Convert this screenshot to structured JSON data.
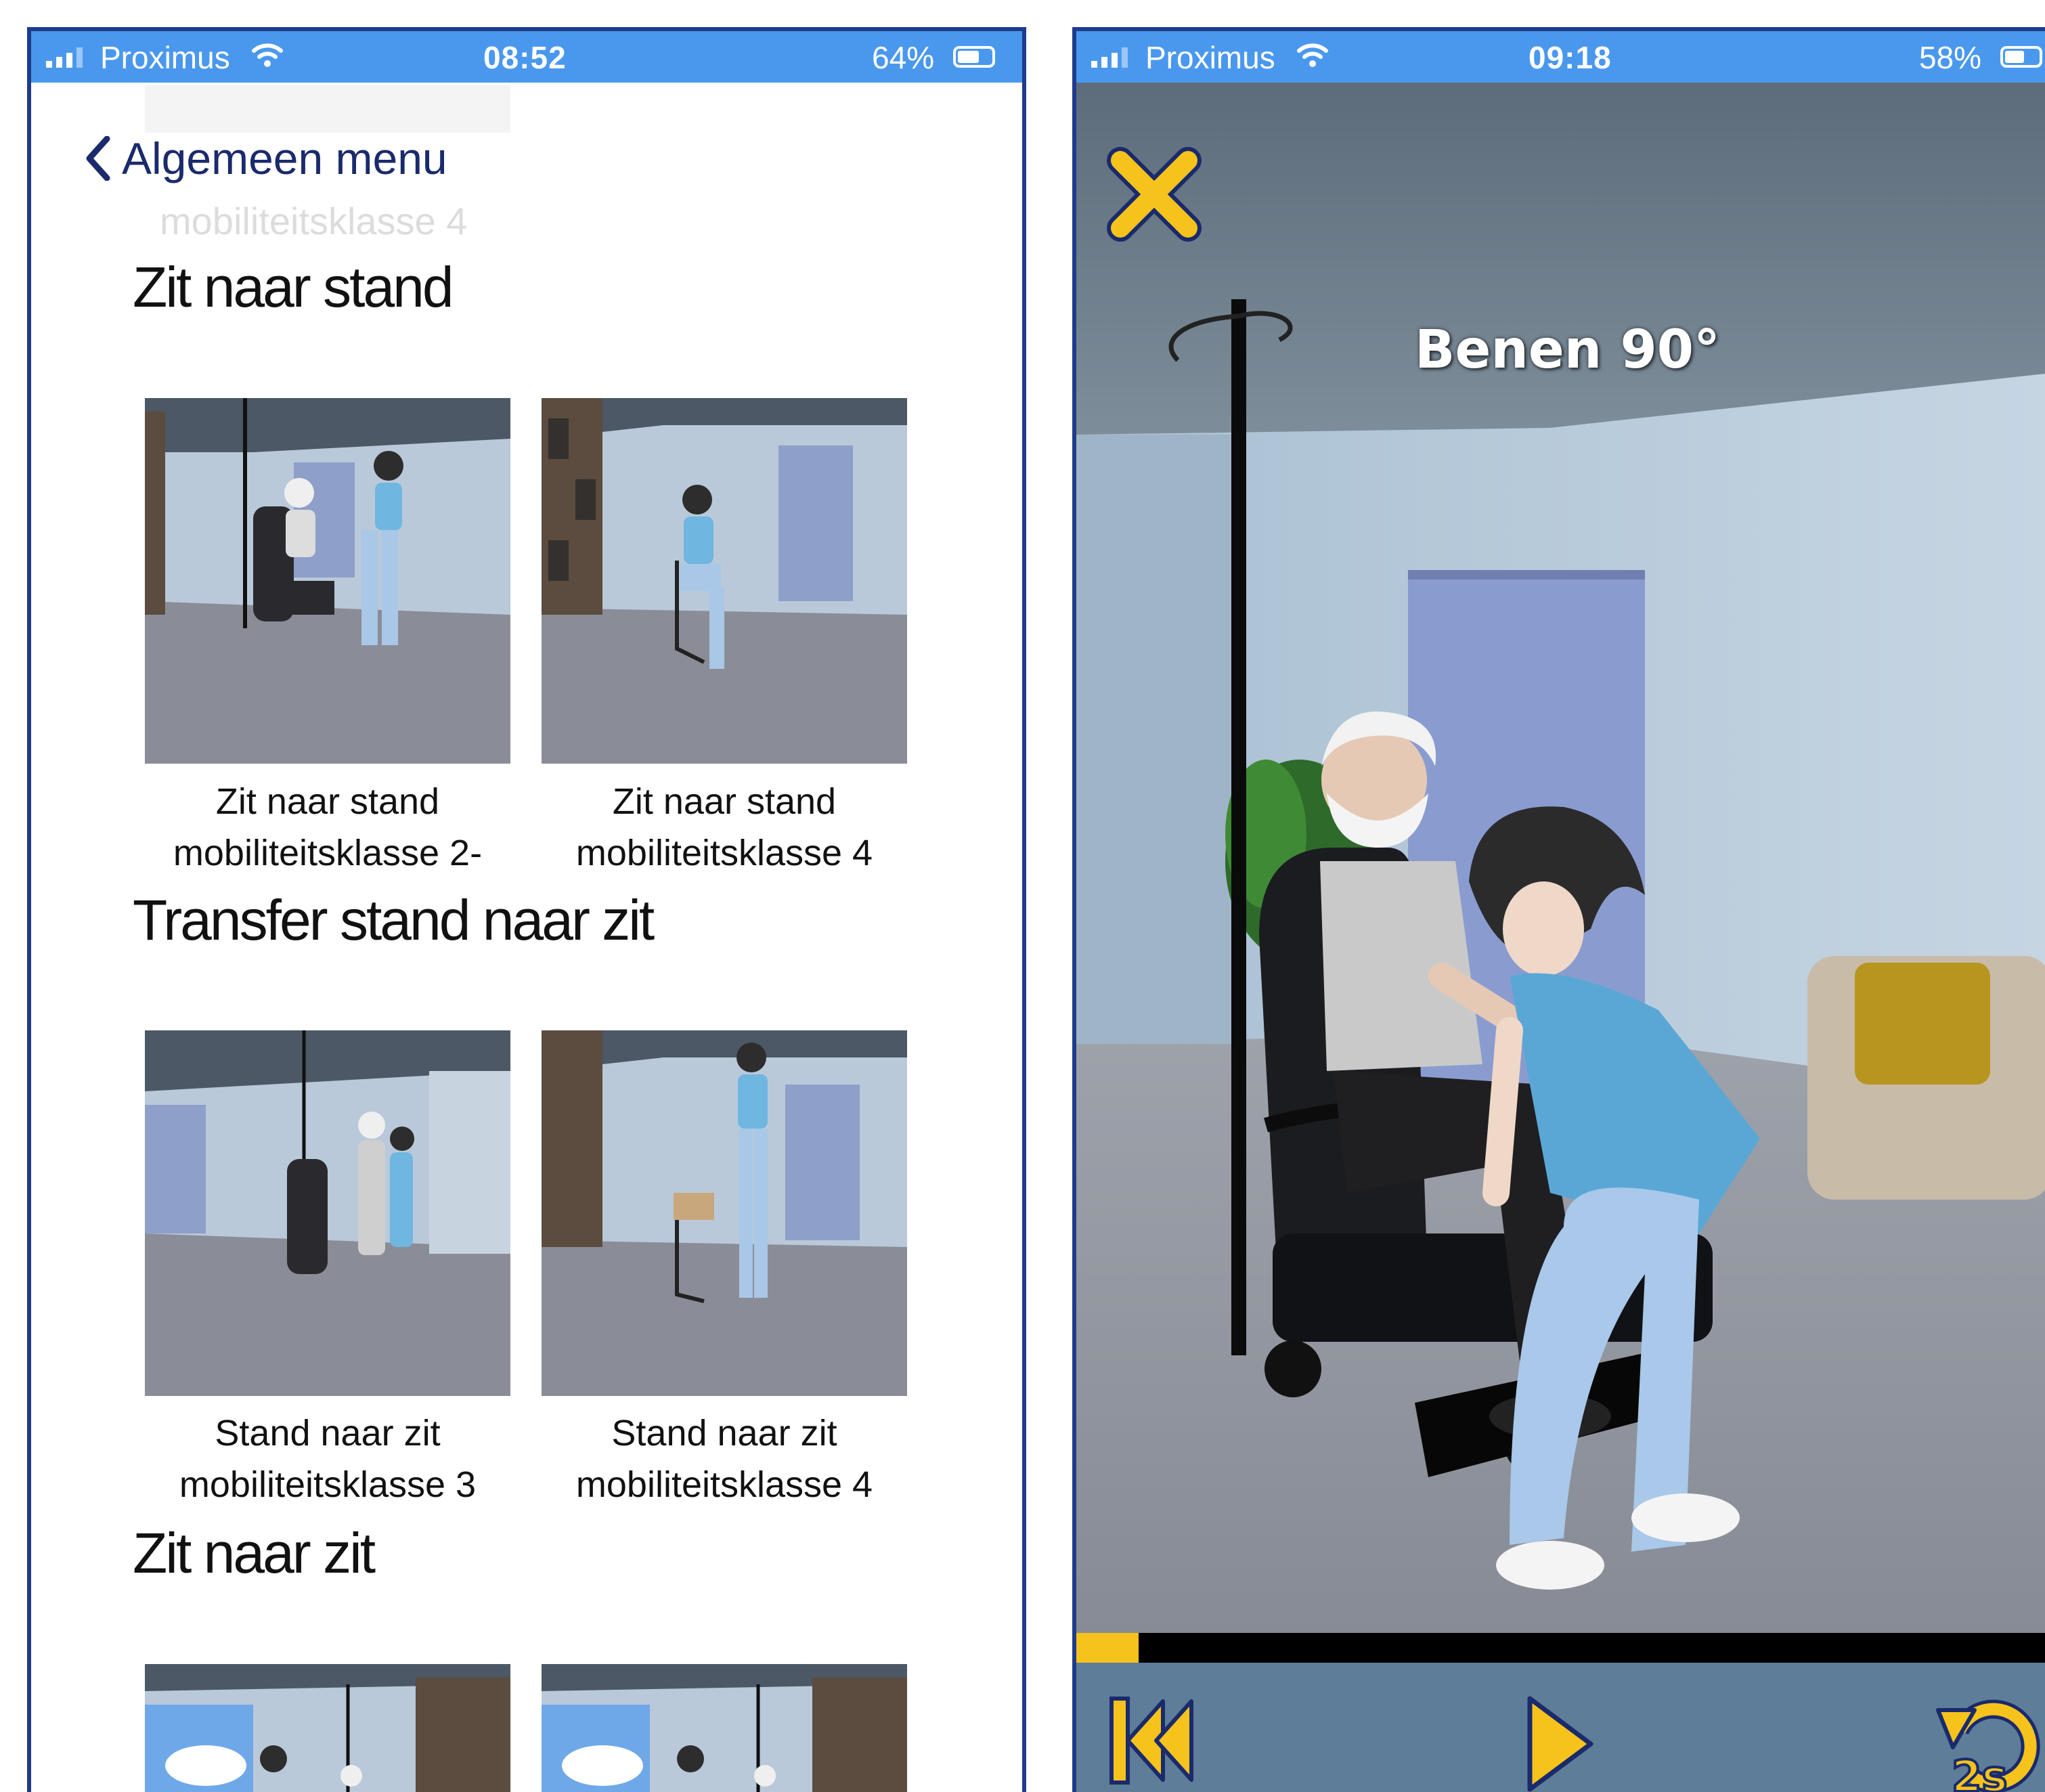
{
  "left": {
    "status": {
      "carrier": "Proximus",
      "time": "08:52",
      "battery": "64%",
      "battery_level": 0.64
    },
    "nav": {
      "back_label": "Algemeen menu",
      "ghost_title": "mobiliteitsklasse 4"
    },
    "sections": [
      {
        "title": "Zit naar stand",
        "items": [
          {
            "caption_line1": "Zit naar stand",
            "caption_line2": "mobiliteitsklasse 2-"
          },
          {
            "caption_line1": "Zit naar stand",
            "caption_line2": "mobiliteitsklasse 4"
          }
        ]
      },
      {
        "title": "Transfer stand naar zit",
        "items": [
          {
            "caption_line1": "Stand naar zit",
            "caption_line2": "mobiliteitsklasse 3"
          },
          {
            "caption_line1": "Stand naar zit",
            "caption_line2": "mobiliteitsklasse 4"
          }
        ]
      },
      {
        "title": "Zit naar zit",
        "items": [
          {},
          {}
        ]
      }
    ]
  },
  "right": {
    "status": {
      "carrier": "Proximus",
      "time": "09:18",
      "battery": "58%",
      "battery_level": 0.58
    },
    "scene_label": "Benen 90°",
    "progress": 0.064,
    "controls": {
      "replay_label": "2s"
    },
    "colors": {
      "accent": "#f5c31c",
      "statusbar": "#4a98ee",
      "frame": "#1e3c8c",
      "controls_bg": "#5d7d99"
    },
    "icons": [
      "close-icon",
      "skip-back-icon",
      "play-icon",
      "replay-2s-icon"
    ]
  }
}
